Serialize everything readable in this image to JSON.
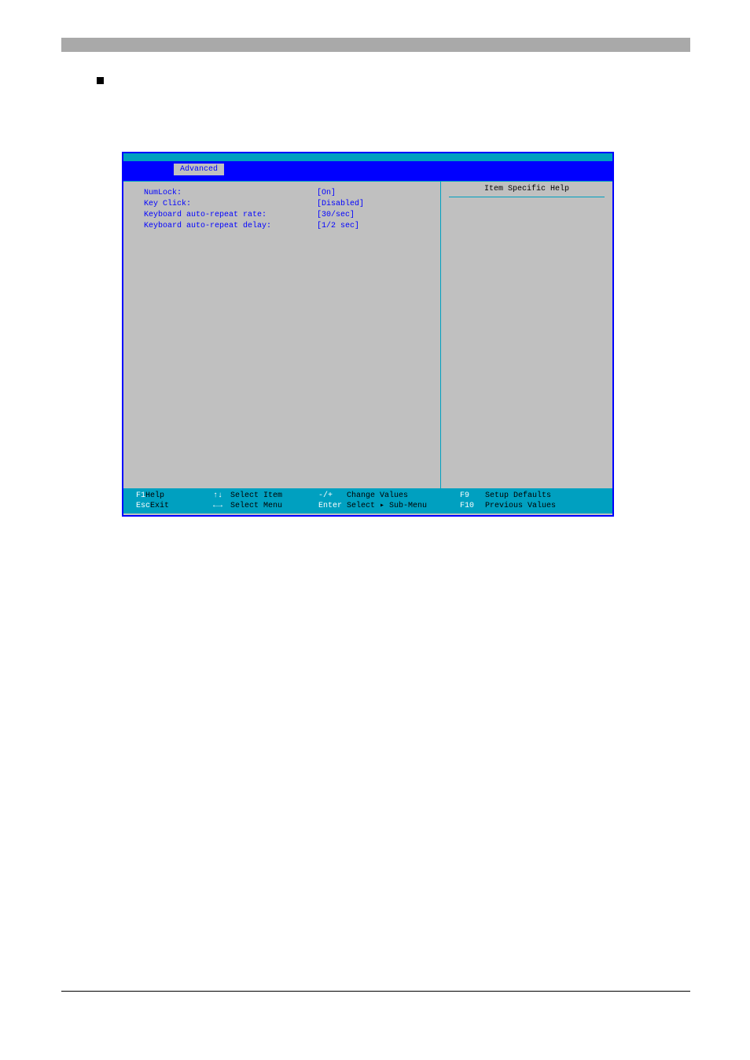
{
  "menu": {
    "active_tab": "Advanced"
  },
  "settings": [
    {
      "label": "NumLock:",
      "value": "[On]"
    },
    {
      "label": "Key Click:",
      "value": "[Disabled]"
    },
    {
      "label": "Keyboard auto-repeat rate:",
      "value": "[30/sec]"
    },
    {
      "label": "Keyboard auto-repeat delay:",
      "value": "[1/2 sec]"
    }
  ],
  "help": {
    "title": "Item Specific Help"
  },
  "footer": {
    "f1": {
      "key": "F1",
      "label": "Help"
    },
    "updown": {
      "key": "↑↓",
      "label": "Select Item"
    },
    "minusplus": {
      "key": "-/+",
      "label": "Change Values"
    },
    "f9": {
      "key": "F9",
      "label": "Setup Defaults"
    },
    "esc": {
      "key": "Esc",
      "label": "Exit"
    },
    "leftright": {
      "key": "←→",
      "label": "Select Menu"
    },
    "enter": {
      "key": "Enter",
      "label": "Select ▸ Sub-Menu"
    },
    "f10": {
      "key": "F10",
      "label": "Previous Values"
    }
  }
}
